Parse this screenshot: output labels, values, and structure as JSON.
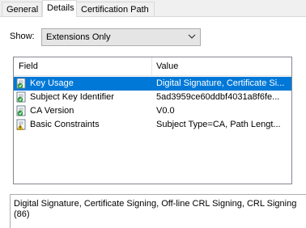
{
  "tabs": [
    {
      "label": "General"
    },
    {
      "label": "Details"
    },
    {
      "label": "Certification Path"
    }
  ],
  "show": {
    "label": "Show:",
    "value": "Extensions Only"
  },
  "list": {
    "columns": [
      "Field",
      "Value"
    ],
    "rows": [
      {
        "field": "Key Usage",
        "value": "Digital Signature, Certificate Si...",
        "icon": "certificate-extension-critical-icon"
      },
      {
        "field": "Subject Key Identifier",
        "value": "5ad3959ce60ddbf4031a8f6fe...",
        "icon": "certificate-extension-icon"
      },
      {
        "field": "CA Version",
        "value": "V0.0",
        "icon": "certificate-extension-icon"
      },
      {
        "field": "Basic Constraints",
        "value": "Subject Type=CA, Path Lengt...",
        "icon": "certificate-extension-warning-icon"
      }
    ],
    "selected_index": 0
  },
  "detail_text": "Digital Signature, Certificate Signing, Off-line CRL Signing, CRL Signing (86)",
  "colors": {
    "selection": "#0078d7",
    "window_bg": "#f0f0f0"
  }
}
